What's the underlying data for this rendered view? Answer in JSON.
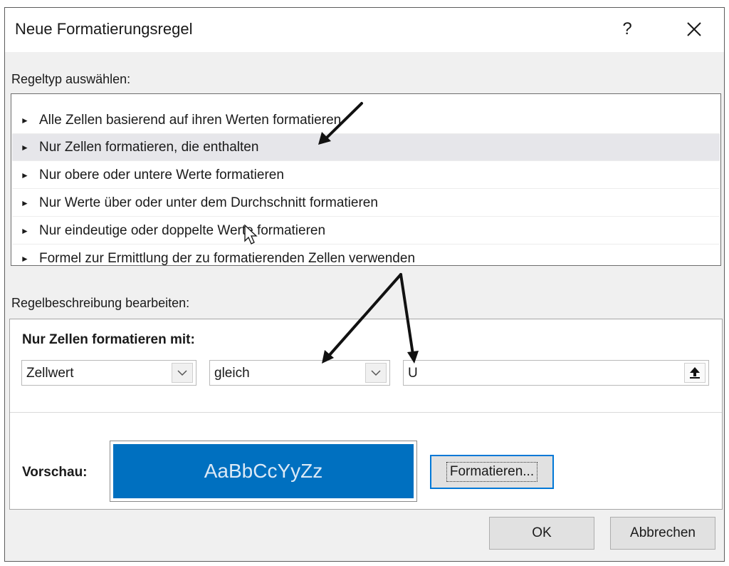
{
  "dialog": {
    "title": "Neue Formatierungsregel",
    "help_label": "?",
    "close_icon": "close-icon"
  },
  "rule_type": {
    "label": "Regeltyp auswählen:",
    "items": [
      {
        "label": "Alle Zellen basierend auf ihren Werten formatieren",
        "selected": false
      },
      {
        "label": "Nur Zellen formatieren, die enthalten",
        "selected": true
      },
      {
        "label": "Nur obere oder untere Werte formatieren",
        "selected": false
      },
      {
        "label": "Nur Werte über oder unter dem Durchschnitt formatieren",
        "selected": false
      },
      {
        "label": "Nur eindeutige oder doppelte Werte formatieren",
        "selected": false
      },
      {
        "label": "Formel zur Ermittlung der zu formatierenden Zellen verwenden",
        "selected": false
      }
    ],
    "item_icon": "►"
  },
  "description": {
    "label": "Regelbeschreibung bearbeiten:",
    "title": "Nur Zellen formatieren mit:",
    "condition_1": "Zellwert",
    "condition_2": "gleich",
    "value": "U",
    "preview_label": "Vorschau:",
    "preview_text": "AaBbCcYyZz",
    "preview_color": "#0070c0",
    "format_button": "Formatieren..."
  },
  "footer": {
    "ok": "OK",
    "cancel": "Abbrechen"
  }
}
